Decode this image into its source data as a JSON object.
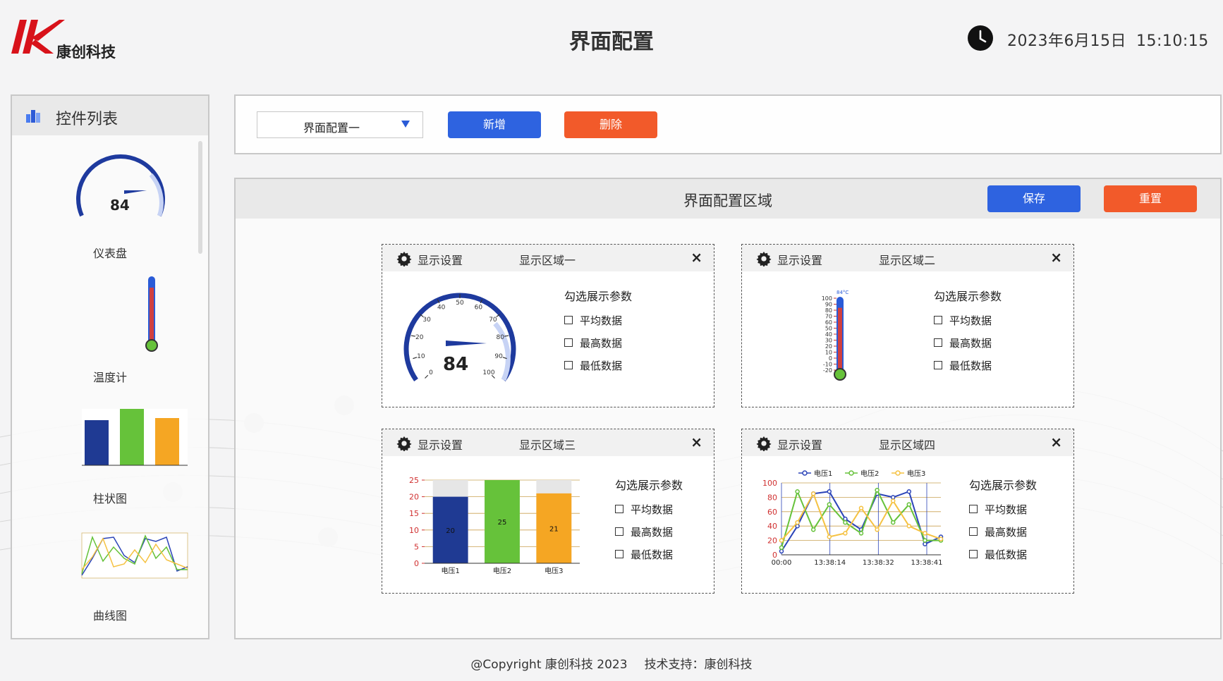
{
  "header": {
    "company": "康创科技",
    "title": "界面配置",
    "date": "2023年6月15日",
    "time": "15:10:15"
  },
  "sidebar": {
    "title": "控件列表",
    "widgets": [
      {
        "label": "仪表盘"
      },
      {
        "label": "温度计"
      },
      {
        "label": "柱状图"
      },
      {
        "label": "曲线图"
      }
    ]
  },
  "toolbar": {
    "select_value": "界面配置一",
    "add_label": "新增",
    "delete_label": "删除"
  },
  "config": {
    "title": "界面配置区域",
    "save_label": "保存",
    "reset_label": "重置",
    "panels": [
      {
        "settings_label": "显示设置",
        "name": "显示区域一",
        "close": "×",
        "options_title": "勾选展示参数",
        "options": [
          "平均数据",
          "最高数据",
          "最低数据"
        ]
      },
      {
        "settings_label": "显示设置",
        "name": "显示区域二",
        "close": "×",
        "options_title": "勾选展示参数",
        "options": [
          "平均数据",
          "最高数据",
          "最低数据"
        ]
      },
      {
        "settings_label": "显示设置",
        "name": "显示区域三",
        "close": "×",
        "options_title": "勾选展示参数",
        "options": [
          "平均数据",
          "最高数据",
          "最低数据"
        ]
      },
      {
        "settings_label": "显示设置",
        "name": "显示区域四",
        "close": "×",
        "options_title": "勾选展示参数",
        "options": [
          "平均数据",
          "最高数据",
          "最低数据"
        ]
      }
    ]
  },
  "gauge": {
    "value": 84,
    "min": 0,
    "max": 100,
    "ticks": [
      "0",
      "10",
      "20",
      "30",
      "40",
      "50",
      "60",
      "70",
      "80",
      "90",
      "100"
    ]
  },
  "thermometer": {
    "label": "84°C",
    "value": 84,
    "ticks": [
      "100",
      "90",
      "80",
      "70",
      "60",
      "50",
      "40",
      "30",
      "20",
      "10",
      "0",
      "-10",
      "-20"
    ]
  },
  "chart_data": [
    {
      "type": "bar",
      "categories": [
        "电压1",
        "电压2",
        "电压3"
      ],
      "values": [
        20,
        25,
        21
      ],
      "ylim": [
        0,
        25
      ],
      "yticks": [
        "0",
        "5",
        "10",
        "15",
        "20",
        "25"
      ],
      "colors": [
        "#1f3a93",
        "#66c23a",
        "#f5a623"
      ]
    },
    {
      "type": "line",
      "x": [
        "00:00",
        "13:38:14",
        "13:38:32",
        "13:38:41"
      ],
      "ylim": [
        0,
        100
      ],
      "yticks": [
        "0",
        "20",
        "40",
        "60",
        "80",
        "100"
      ],
      "series": [
        {
          "name": "电压1",
          "color": "#2b44b8",
          "values": [
            5,
            40,
            85,
            88,
            50,
            35,
            85,
            80,
            88,
            15,
            25
          ]
        },
        {
          "name": "电压2",
          "color": "#66c23a",
          "values": [
            10,
            88,
            35,
            70,
            45,
            30,
            90,
            45,
            70,
            20,
            20
          ]
        },
        {
          "name": "电压3",
          "color": "#f5c242",
          "values": [
            20,
            45,
            85,
            25,
            30,
            65,
            35,
            75,
            40,
            30,
            22
          ]
        }
      ]
    }
  ],
  "footer": {
    "copyright": "@Copyright 康创科技 2023",
    "support": "技术支持：康创科技"
  }
}
